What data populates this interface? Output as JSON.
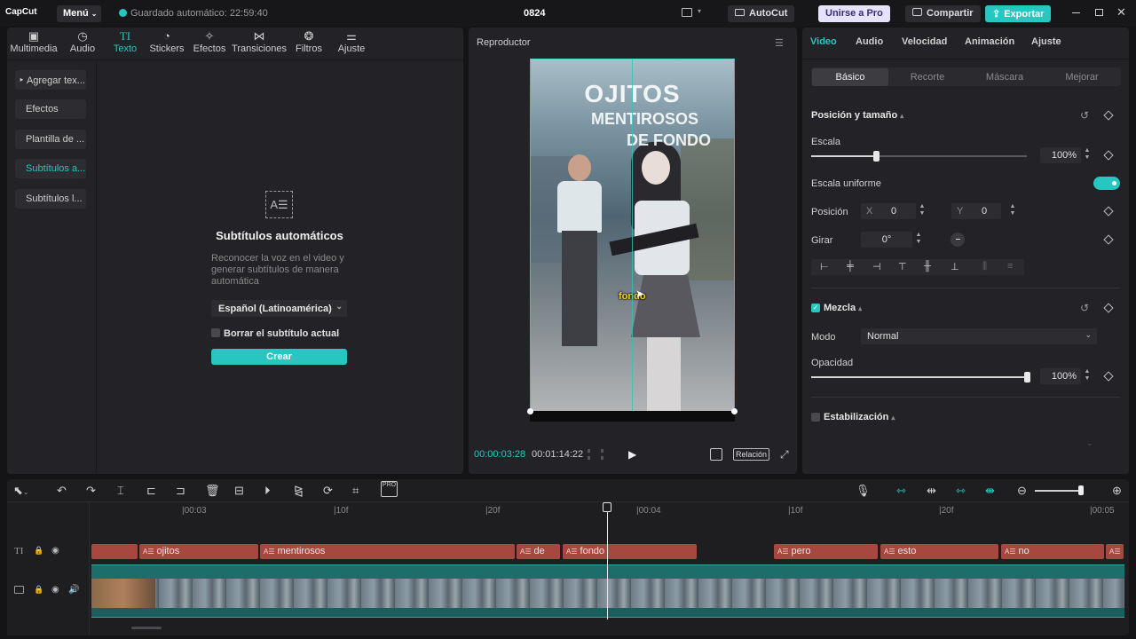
{
  "app": {
    "logo": "CapCut",
    "menu_label": "Menú",
    "autosave": "Guardado automático: 22:59:40",
    "project_title": "0824",
    "autocut_label": "AutoCut",
    "pro_label": "Unirse a Pro",
    "share_label": "Compartir",
    "export_label": "Exportar",
    "accent_color": "#28c6c0"
  },
  "toolbar": {
    "items": [
      {
        "label": "Multimedia",
        "icon": "media-icon"
      },
      {
        "label": "Audio",
        "icon": "audio-icon"
      },
      {
        "label": "Texto",
        "icon": "text-icon",
        "active": true
      },
      {
        "label": "Stickers",
        "icon": "sticker-icon"
      },
      {
        "label": "Efectos",
        "icon": "effects-icon"
      },
      {
        "label": "Transiciones",
        "icon": "transitions-icon"
      },
      {
        "label": "Filtros",
        "icon": "filters-icon"
      },
      {
        "label": "Ajuste",
        "icon": "adjust-icon"
      }
    ]
  },
  "sidebar": {
    "items": [
      {
        "label": "‣ Agregar tex..."
      },
      {
        "label": "Efectos"
      },
      {
        "label": "Plantilla de ..."
      },
      {
        "label": "Subtítulos a...",
        "active": true
      },
      {
        "label": "Subtítulos l..."
      }
    ]
  },
  "autosubs": {
    "title": "Subtítulos automáticos",
    "description": "Reconocer la voz en el video y generar subtítulos de manera automática",
    "language": "Español (Latinoamérica)",
    "checkbox_label": "Borrar el subtítulo actual",
    "create_label": "Crear"
  },
  "player": {
    "title": "Reproductor",
    "current_time": "00:00:03:28",
    "total_time": "00:01:14:22",
    "ratio_label": "Relación",
    "overlay_title": [
      "OJITOS",
      "MENTIROSOS",
      "DE FONDO"
    ],
    "caption": "fondo"
  },
  "inspector": {
    "tabs": [
      "Video",
      "Audio",
      "Velocidad",
      "Animación",
      "Ajuste"
    ],
    "subtabs": [
      "Básico",
      "Recorte",
      "Máscara",
      "Mejorar"
    ],
    "pos_section": "Posición y tamaño",
    "scale_label": "Escala",
    "scale_value": "100%",
    "scale_level": 0.3,
    "uniform_label": "Escala uniforme",
    "position_label": "Posición",
    "x_label": "X",
    "x_value": "0",
    "y_label": "Y",
    "y_value": "0",
    "rotate_label": "Girar",
    "rotate_value": "0°",
    "blend_section": "Mezcla",
    "mode_label": "Modo",
    "mode_value": "Normal",
    "opacity_label": "Opacidad",
    "opacity_value": "100%",
    "opacity_level": 1.0,
    "stab_section": "Estabilización"
  },
  "timeline": {
    "ruler": [
      "|00:03",
      "|10f",
      "|20f",
      "|00:04",
      "|10f",
      "|20f",
      "|00:05"
    ],
    "text_clips": [
      {
        "label": ""
      },
      {
        "label": "ojitos"
      },
      {
        "label": "mentirosos"
      },
      {
        "label": "de"
      },
      {
        "label": "fondo"
      },
      {
        "label": "pero"
      },
      {
        "label": "esto"
      },
      {
        "label": "no"
      },
      {
        "label": "e"
      }
    ]
  }
}
